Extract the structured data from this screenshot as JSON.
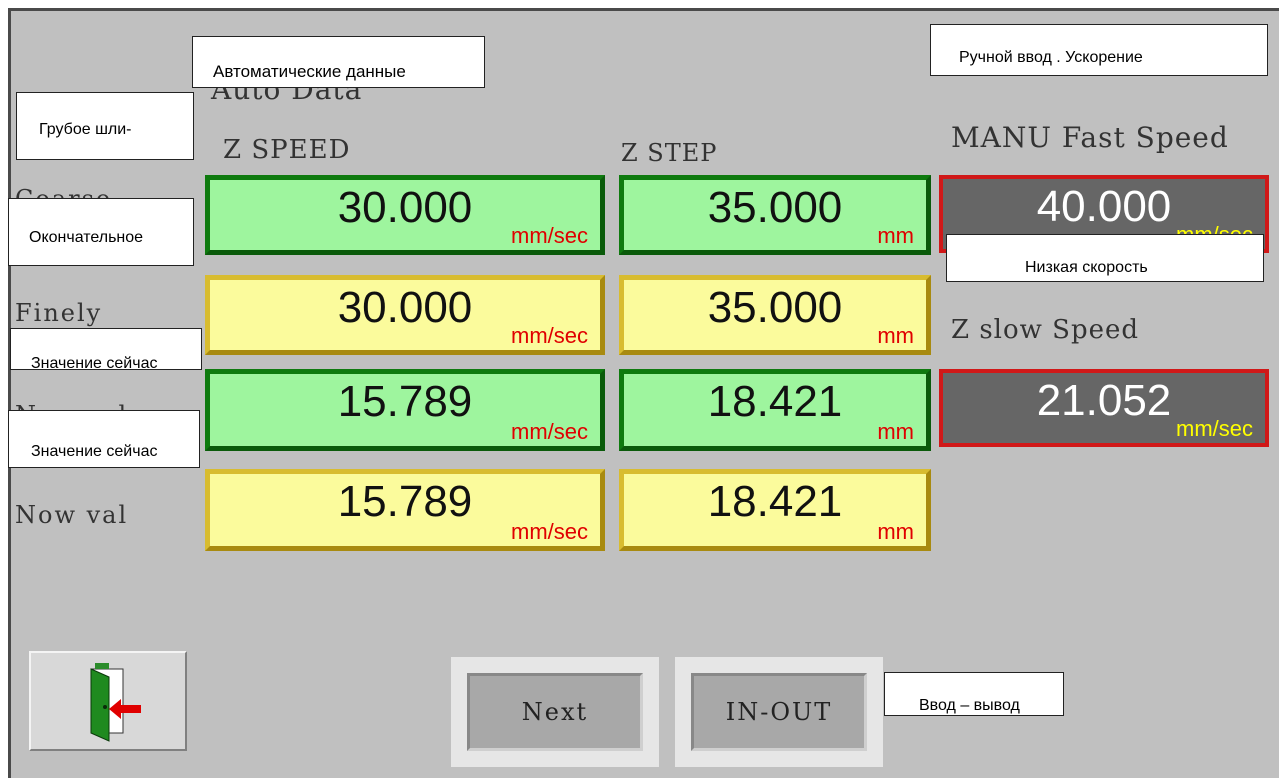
{
  "header": {
    "auto_data_label": "Auto Data"
  },
  "columns": {
    "z_speed": "Z SPEED",
    "z_step": "Z STEP",
    "manu_fast_speed": "MANU Fast Speed",
    "z_slow_speed": "Z slow Speed"
  },
  "rows": [
    {
      "label": "Coarse",
      "speed": "30.000",
      "speed_unit": "mm/sec",
      "step": "35.000",
      "step_unit": "mm"
    },
    {
      "label": "Finely",
      "speed": "30.000",
      "speed_unit": "mm/sec",
      "step": "35.000",
      "step_unit": "mm"
    },
    {
      "label": "Now val",
      "speed": "15.789",
      "speed_unit": "mm/sec",
      "step": "18.421",
      "step_unit": "mm"
    },
    {
      "label": "Now val",
      "speed": "15.789",
      "speed_unit": "mm/sec",
      "step": "18.421",
      "step_unit": "mm"
    }
  ],
  "manu_fast": {
    "value": "40.000",
    "unit": "mm/sec"
  },
  "z_slow": {
    "value": "21.052",
    "unit": "mm/sec"
  },
  "buttons": {
    "next": "Next",
    "in_out": "IN-OUT"
  },
  "overlays": {
    "auto_data": "Автоматические данные",
    "manual_accel": "Ручной ввод . Ускорение",
    "coarse": "Грубое шли-",
    "final": "Окончательное",
    "low_speed": "Низкая скорость",
    "now_val_1": "Значение сейчас",
    "now_val_2": "Значение сейчас",
    "in_out": "Ввод – вывод"
  },
  "colors": {
    "green_field": "#9ef59e",
    "yellow_field": "#fbfb9c",
    "readonly_field": "#666666",
    "red_unit": "#e00000",
    "yellow_unit": "#ffff00"
  }
}
